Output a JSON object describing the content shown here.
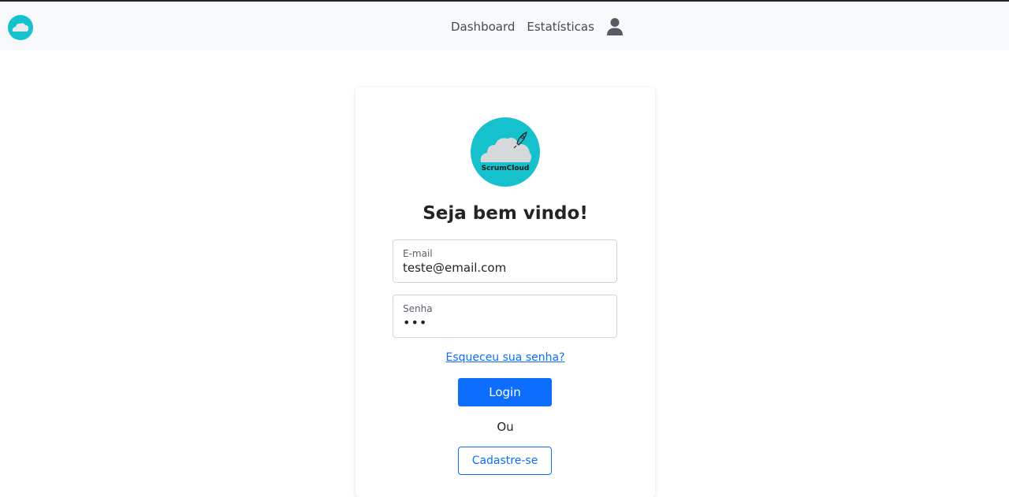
{
  "navbar": {
    "links": [
      "Dashboard",
      "Estatísticas"
    ],
    "brand_icon": "cloud-logo-icon",
    "user_icon": "user-icon"
  },
  "login": {
    "logo_text": "ScrumCloud",
    "title": "Seja bem vindo!",
    "email_label": "E-mail",
    "email_value": "teste@email.com",
    "password_label": "Senha",
    "password_value": "abc",
    "forgot_link": "Esqueceu sua senha?",
    "login_button": "Login",
    "or_text": "Ou",
    "register_button": "Cadastre-se"
  },
  "colors": {
    "primary": "#0d6efd",
    "brand_teal": "#14c1cd",
    "navbar_bg": "#f8f9fa"
  }
}
